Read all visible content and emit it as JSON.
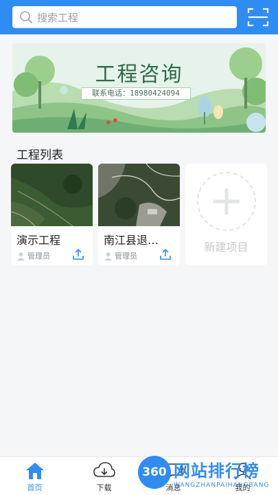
{
  "search": {
    "placeholder": "搜索工程"
  },
  "banner": {
    "title": "工程咨询",
    "phone": "联系电话：18980424094"
  },
  "section": {
    "title": "工程列表"
  },
  "projects": [
    {
      "name": "演示工程",
      "owner": "管理员"
    },
    {
      "name": "南江县退…",
      "owner": "管理员"
    }
  ],
  "new_project": {
    "label": "新建项目"
  },
  "tabs": [
    {
      "label": "首页",
      "active": true,
      "icon": "home-icon"
    },
    {
      "label": "下载",
      "active": false,
      "icon": "cloud-download-icon"
    },
    {
      "label": "消息",
      "active": false,
      "icon": "message-icon"
    },
    {
      "label": "我的",
      "active": false,
      "icon": "user-icon"
    }
  ],
  "watermark": {
    "text": "网站排行榜",
    "badge": "360",
    "sub": "WANGZHANPAIHANGBANG"
  },
  "colors": {
    "primary": "#2f8cf5",
    "background": "#f5f6f8"
  }
}
